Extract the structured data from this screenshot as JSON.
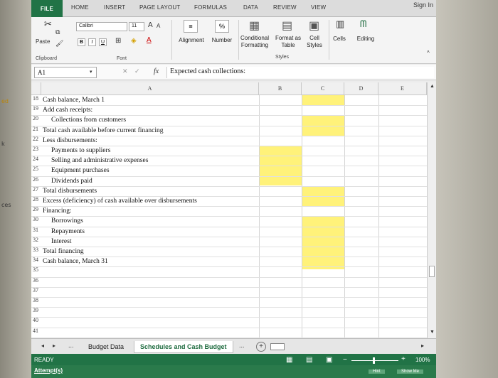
{
  "side_text": [
    "ed",
    "k",
    "ces"
  ],
  "ribbon": {
    "tabs": [
      "FILE",
      "HOME",
      "INSERT",
      "PAGE LAYOUT",
      "FORMULAS",
      "DATA",
      "REVIEW",
      "VIEW"
    ],
    "sign_in": "Sign In",
    "font_name": "Calibri",
    "font_size": "11",
    "paste_label": "Paste",
    "clipboard_label": "Clipboard",
    "font_group_label": "Font",
    "alignment_label": "Alignment",
    "number_label": "Number",
    "cond_format_label": [
      "Conditional",
      "Formatting"
    ],
    "format_table_label": [
      "Format as",
      "Table"
    ],
    "cell_styles_label": [
      "Cell",
      "Styles"
    ],
    "styles_group_label": "Styles",
    "cells_label": "Cells",
    "editing_label": "Editing",
    "bold": "B",
    "italic": "I",
    "underline": "U",
    "percent": "%",
    "grow_font": "A",
    "shrink_font": "A"
  },
  "formula_bar": {
    "name_box": "A1",
    "fx": "fx",
    "content": "Expected cash collections:"
  },
  "grid": {
    "columns": [
      "A",
      "B",
      "C",
      "D",
      "E"
    ],
    "rows": [
      {
        "n": "18",
        "text": "Cash balance, March 1",
        "indent": 0
      },
      {
        "n": "19",
        "text": "Add cash receipts:",
        "indent": 0
      },
      {
        "n": "20",
        "text": "Collections from customers",
        "indent": 1
      },
      {
        "n": "21",
        "text": "Total cash available before current financing",
        "indent": 0
      },
      {
        "n": "22",
        "text": "Less disbursements:",
        "indent": 0
      },
      {
        "n": "23",
        "text": "Payments to suppliers",
        "indent": 1
      },
      {
        "n": "24",
        "text": "Selling and administrative expenses",
        "indent": 1
      },
      {
        "n": "25",
        "text": "Equipment purchases",
        "indent": 1
      },
      {
        "n": "26",
        "text": "Dividends paid",
        "indent": 1
      },
      {
        "n": "27",
        "text": "Total disbursements",
        "indent": 0
      },
      {
        "n": "28",
        "text": "Excess (deficiency) of cash available over disbursements",
        "indent": 0
      },
      {
        "n": "29",
        "text": "Financing:",
        "indent": 0
      },
      {
        "n": "30",
        "text": "Borrowings",
        "indent": 1
      },
      {
        "n": "31",
        "text": "Repayments",
        "indent": 1
      },
      {
        "n": "32",
        "text": "Interest",
        "indent": 1
      },
      {
        "n": "33",
        "text": "Total financing",
        "indent": 0
      },
      {
        "n": "34",
        "text": "Cash balance, March 31",
        "indent": 0
      },
      {
        "n": "35",
        "text": "",
        "indent": 0
      },
      {
        "n": "36",
        "text": "",
        "indent": 0
      },
      {
        "n": "37",
        "text": "",
        "indent": 0
      },
      {
        "n": "38",
        "text": "",
        "indent": 0
      },
      {
        "n": "39",
        "text": "",
        "indent": 0
      },
      {
        "n": "40",
        "text": "",
        "indent": 0
      },
      {
        "n": "41",
        "text": "",
        "indent": 0
      }
    ]
  },
  "sheets": {
    "ellipsis": "...",
    "tabs": [
      "Budget Data",
      "Schedules and Cash Budget"
    ],
    "active": "Schedules and Cash Budget",
    "more": "..."
  },
  "status": {
    "ready": "READY",
    "attempts": "Attempt(s)",
    "zoom": "100%",
    "hint": "Hint",
    "show_me": "Show Me"
  },
  "colors": {
    "excel_green": "#217346",
    "input_yellow": "#fff27a"
  }
}
